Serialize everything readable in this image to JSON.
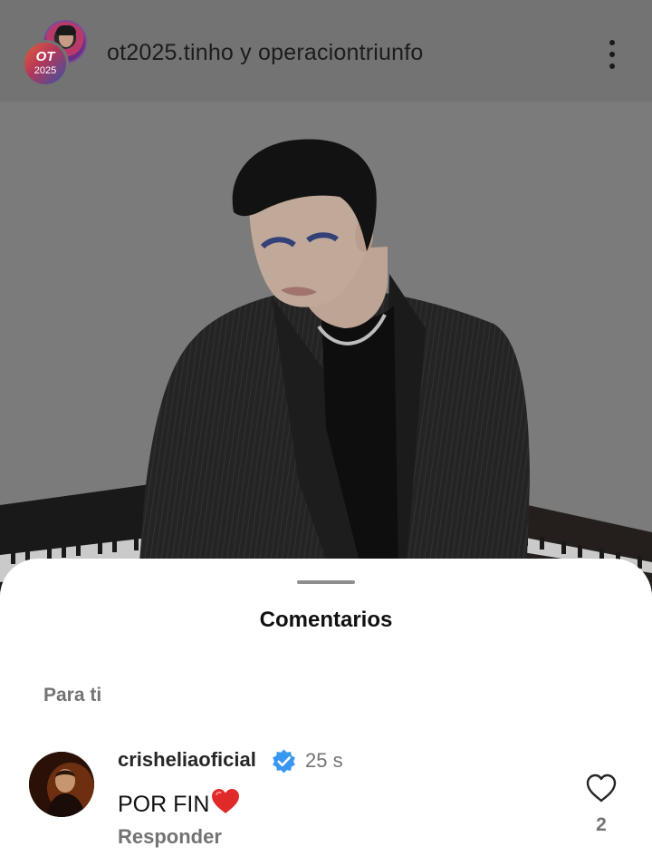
{
  "header": {
    "title": "ot2025.tinho y operaciontriunfo",
    "avatar_front": {
      "logo_text": "OT",
      "year_text": "2025"
    },
    "more_icon": "more-vertical-icon"
  },
  "photo": {
    "description_icon": "post-photo"
  },
  "sheet": {
    "title": "Comentarios",
    "section_label": "Para ti"
  },
  "comments": [
    {
      "username": "crisheliaoficial",
      "verified": true,
      "time": "25 s",
      "text": "POR FIN",
      "emoji": "red-heart",
      "reply_label": "Responder",
      "likes": "2"
    }
  ],
  "colors": {
    "verified": "#3897f0",
    "heart_emoji": "#e02a2a",
    "secondary_text": "#737373"
  }
}
